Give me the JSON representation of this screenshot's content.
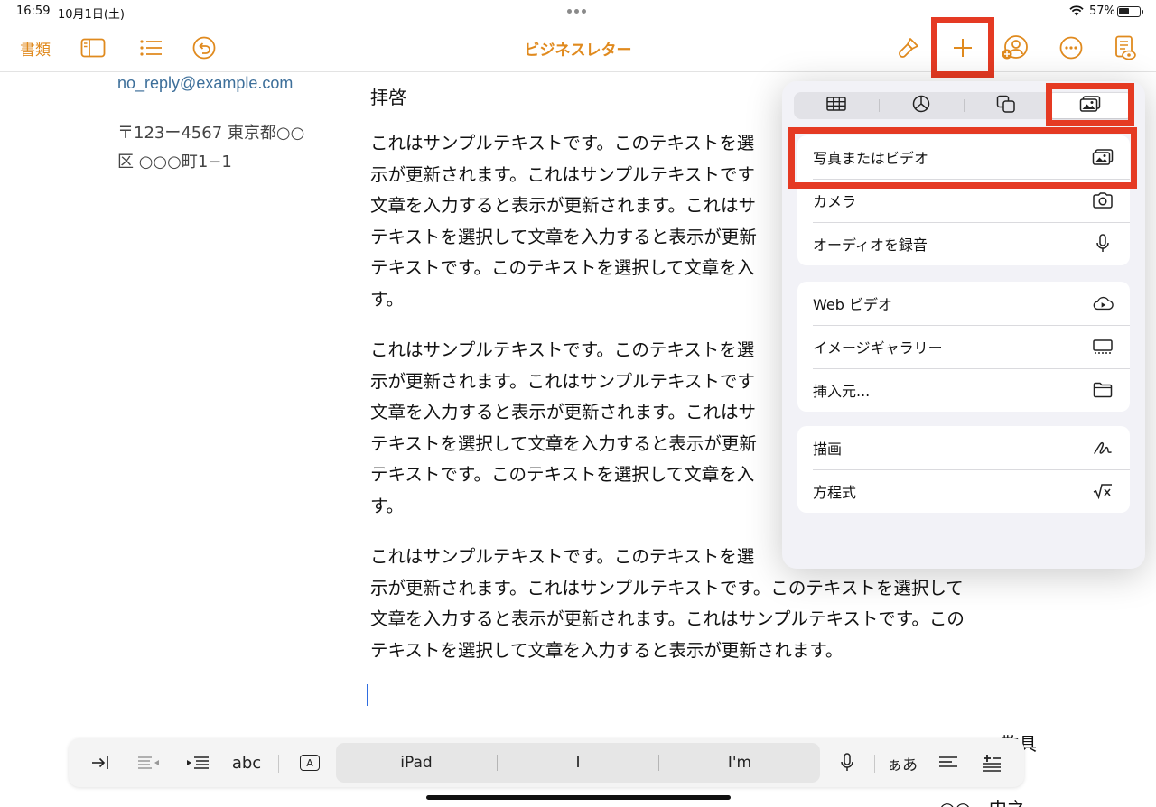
{
  "status_bar": {
    "time": "16:59",
    "date": "10月1日(土)",
    "battery_text": "57%",
    "battery_level": 0.57
  },
  "toolbar": {
    "docs_label": "書類",
    "title": "ビジネスレター",
    "accent_color": "#e08a1e",
    "icons": [
      "sidebar-icon",
      "list-icon",
      "undo-icon",
      "paintbrush-icon",
      "plus-icon",
      "add-person-icon",
      "more-icon",
      "reading-view-icon"
    ]
  },
  "document": {
    "email": "no_reply@example.com",
    "address_line1": "〒123ー4567 東京都○○",
    "address_line2": "区 ○○○町1−1",
    "greeting": "拝啓",
    "paragraphs": [
      [
        "これはサンプルテキストです。このテキストを選",
        "示が更新されます。これはサンプルテキストです",
        "文章を入力すると表示が更新されます。これはサ",
        "テキストを選択して文章を入力すると表示が更新",
        "テキストです。このテキストを選択して文章を入",
        "す。"
      ],
      [
        "これはサンプルテキストです。このテキストを選",
        "示が更新されます。これはサンプルテキストです",
        "文章を入力すると表示が更新されます。これはサ",
        "テキストを選択して文章を入力すると表示が更新",
        "テキストです。このテキストを選択して文章を入",
        "す。"
      ],
      [
        "これはサンプルテキストです。このテキストを選",
        "示が更新されます。これはサンプルテキストです。このテキストを選択して",
        "文章を入力すると表示が更新されます。これはサンプルテキストです。この",
        "テキストを選択して文章を入力すると表示が更新されます。"
      ]
    ],
    "closing": "敬具",
    "signature": "○○　中之"
  },
  "popover": {
    "tabs": [
      "table-icon",
      "chart-icon",
      "shapes-icon",
      "media-icon"
    ],
    "active_tab": 3,
    "group1": [
      {
        "label": "写真またはビデオ",
        "icon": "photo-icon"
      },
      {
        "label": "カメラ",
        "icon": "camera-icon"
      },
      {
        "label": "オーディオを録音",
        "icon": "microphone-icon"
      }
    ],
    "group2": [
      {
        "label": "Web ビデオ",
        "icon": "cloud-play-icon"
      },
      {
        "label": "イメージギャラリー",
        "icon": "gallery-icon"
      },
      {
        "label": "挿入元...",
        "icon": "folder-icon"
      }
    ],
    "group3": [
      {
        "label": "描画",
        "icon": "drawing-icon"
      },
      {
        "label": "方程式",
        "icon": "sqrt-icon"
      }
    ],
    "highlight_color": "#e53a23"
  },
  "format_bar": {
    "abc_label": "abc",
    "a_label": "A",
    "suggestions": [
      "iPad",
      "I",
      "I'm"
    ],
    "kana_label": "ぁあ"
  }
}
